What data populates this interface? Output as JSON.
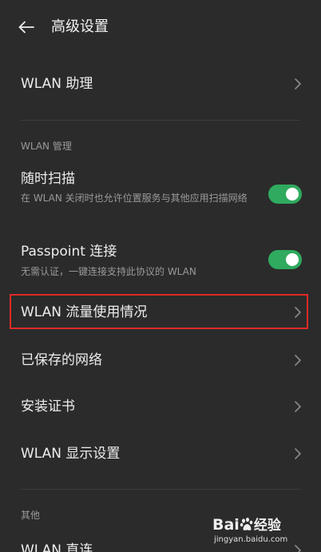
{
  "header": {
    "title": "高级设置",
    "back_icon": "arrow-left-icon"
  },
  "items": {
    "wlan_assistant": "WLAN 助理",
    "wlan_usage": "WLAN 流量使用情况",
    "saved_networks": "已保存的网络",
    "install_cert": "安装证书",
    "wlan_display": "WLAN 显示设置",
    "wlan_direct": "WLAN 直连"
  },
  "sections": {
    "wlan_manage": "WLAN 管理",
    "other": "其他"
  },
  "toggles": {
    "scan_anytime": {
      "title": "随时扫描",
      "subtitle": "在 WLAN 关闭时也允许位置服务与其他应用扫描网络",
      "on": true
    },
    "passpoint": {
      "title": "Passpoint 连接",
      "subtitle": "无需认证，一键连接支持此协议的 WLAN",
      "on": true
    }
  },
  "watermark": {
    "brand_left": "Bai",
    "brand_right": "经验",
    "url": "jingyan.baidu.com"
  },
  "colors": {
    "background": "#2b2b2b",
    "toggle_on": "#2faa5e",
    "highlight": "#e02a26"
  }
}
